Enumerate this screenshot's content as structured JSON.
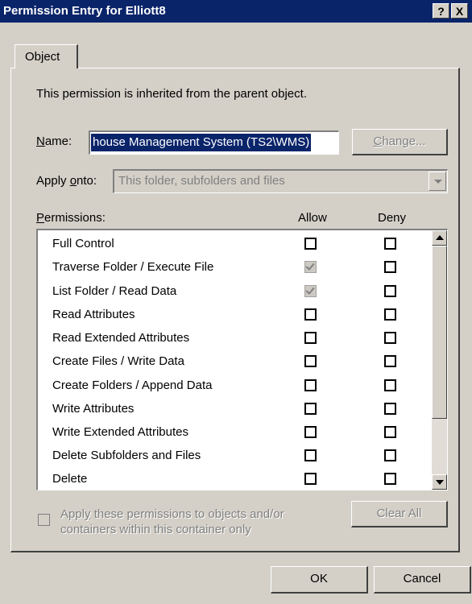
{
  "window": {
    "title": "Permission Entry for Elliott8",
    "help_label": "?",
    "close_label": "X"
  },
  "tabs": [
    {
      "label": "Object",
      "selected": true
    }
  ],
  "inherited_notice": "This permission is inherited from the parent object.",
  "name": {
    "label_prefix": "",
    "label_accel": "N",
    "label_rest": "ame:",
    "value": "house Management System (TS2\\WMS)",
    "change_button_accel": "C",
    "change_button_rest": "hange..."
  },
  "apply_onto": {
    "label_prefix": "Apply ",
    "label_accel": "o",
    "label_rest": "nto:",
    "selected": "This folder, subfolders and files"
  },
  "permissions": {
    "label_accel": "P",
    "label_rest": "ermissions:",
    "allow_header": "Allow",
    "deny_header": "Deny",
    "rows": [
      {
        "name": "Full Control",
        "allow": false,
        "deny": false
      },
      {
        "name": "Traverse Folder / Execute File",
        "allow": true,
        "deny": false
      },
      {
        "name": "List Folder / Read Data",
        "allow": true,
        "deny": false
      },
      {
        "name": "Read Attributes",
        "allow": false,
        "deny": false
      },
      {
        "name": "Read Extended Attributes",
        "allow": false,
        "deny": false
      },
      {
        "name": "Create Files / Write Data",
        "allow": false,
        "deny": false
      },
      {
        "name": "Create Folders / Append Data",
        "allow": false,
        "deny": false
      },
      {
        "name": "Write Attributes",
        "allow": false,
        "deny": false
      },
      {
        "name": "Write Extended Attributes",
        "allow": false,
        "deny": false
      },
      {
        "name": "Delete Subfolders and Files",
        "allow": false,
        "deny": false
      },
      {
        "name": "Delete",
        "allow": false,
        "deny": false
      }
    ]
  },
  "apply_only": {
    "line1_prefix": "Appl",
    "line1_accel": "y",
    "line1_rest": " these permissions to objects and/or",
    "line2": "containers within this container only"
  },
  "clear_all_label": "Clear All",
  "ok_label": "OK",
  "cancel_label": "Cancel"
}
